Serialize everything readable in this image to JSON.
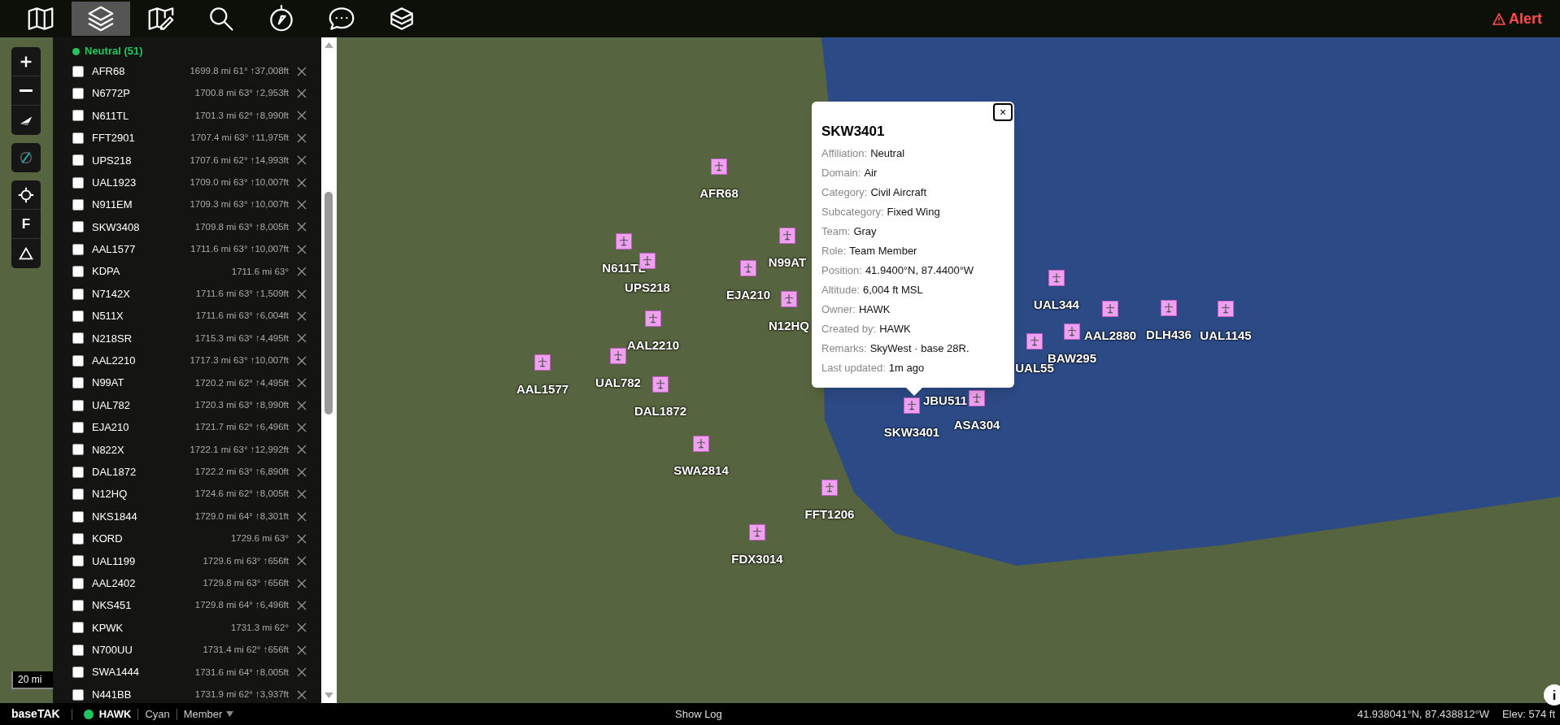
{
  "toolbar": {
    "tools": [
      {
        "kind": "map",
        "selected": false
      },
      {
        "kind": "layers",
        "selected": true
      },
      {
        "kind": "map-edit",
        "selected": false
      },
      {
        "kind": "search",
        "selected": false
      },
      {
        "kind": "compass",
        "selected": false
      },
      {
        "kind": "chat",
        "selected": false
      },
      {
        "kind": "stack",
        "selected": false
      }
    ],
    "alert": {
      "label": "Alert"
    }
  },
  "map_controls": [
    {
      "buttons": [
        {
          "kind": "zoom-in"
        },
        {
          "kind": "zoom-out"
        },
        {
          "kind": "north"
        }
      ]
    },
    {
      "buttons": [
        {
          "kind": "compass-off"
        }
      ]
    },
    {
      "buttons": [
        {
          "kind": "locate"
        },
        {
          "kind": "text",
          "label": "F"
        },
        {
          "kind": "triangle"
        }
      ]
    }
  ],
  "scale": "20 mi",
  "contacts": {
    "group": {
      "label": "Neutral (51)",
      "color": "#22c55e"
    },
    "items": [
      {
        "callsign": "AFR68",
        "info": "1699.8 mi 61° ↑37,008ft",
        "checked": false
      },
      {
        "callsign": "N6772P",
        "info": "1700.8 mi 63° ↑2,953ft",
        "checked": false
      },
      {
        "callsign": "N611TL",
        "info": "1701.3 mi 62° ↑8,990ft",
        "checked": false
      },
      {
        "callsign": "FFT2901",
        "info": "1707.4 mi 63° ↑11,975ft",
        "checked": false
      },
      {
        "callsign": "UPS218",
        "info": "1707.6 mi 62° ↑14,993ft",
        "checked": false
      },
      {
        "callsign": "UAL1923",
        "info": "1709.0 mi 63° ↑10,007ft",
        "checked": false
      },
      {
        "callsign": "N911EM",
        "info": "1709.3 mi 63° ↑10,007ft",
        "checked": false
      },
      {
        "callsign": "SKW3408",
        "info": "1709.8 mi 63° ↑8,005ft",
        "checked": false
      },
      {
        "callsign": "AAL1577",
        "info": "1711.6 mi 63° ↑10,007ft",
        "checked": false
      },
      {
        "callsign": "KDPA",
        "info": "1711.6 mi 63°",
        "checked": false
      },
      {
        "callsign": "N7142X",
        "info": "1711.6 mi 63° ↑1,509ft",
        "checked": false
      },
      {
        "callsign": "N511X",
        "info": "1711.6 mi 63° ↑6,004ft",
        "checked": false
      },
      {
        "callsign": "N218SR",
        "info": "1715.3 mi 63° ↑4,495ft",
        "checked": false
      },
      {
        "callsign": "AAL2210",
        "info": "1717.3 mi 63° ↑10,007ft",
        "checked": false
      },
      {
        "callsign": "N99AT",
        "info": "1720.2 mi 62° ↑4,495ft",
        "checked": false
      },
      {
        "callsign": "UAL782",
        "info": "1720.3 mi 63° ↑8,990ft",
        "checked": false
      },
      {
        "callsign": "EJA210",
        "info": "1721.7 mi 62° ↑6,496ft",
        "checked": false
      },
      {
        "callsign": "N822X",
        "info": "1722.1 mi 63° ↑12,992ft",
        "checked": false
      },
      {
        "callsign": "DAL1872",
        "info": "1722.2 mi 63° ↑6,890ft",
        "checked": false
      },
      {
        "callsign": "N12HQ",
        "info": "1724.6 mi 62° ↑8,005ft",
        "checked": false
      },
      {
        "callsign": "NKS1844",
        "info": "1729.0 mi 64° ↑8,301ft",
        "checked": false
      },
      {
        "callsign": "KORD",
        "info": "1729.6 mi 63°",
        "checked": false
      },
      {
        "callsign": "UAL1199",
        "info": "1729.6 mi 63° ↑656ft",
        "checked": false
      },
      {
        "callsign": "AAL2402",
        "info": "1729.8 mi 63° ↑656ft",
        "checked": false
      },
      {
        "callsign": "NKS451",
        "info": "1729.8 mi 64° ↑6,496ft",
        "checked": false
      },
      {
        "callsign": "KPWK",
        "info": "1731.3 mi 62°",
        "checked": false
      },
      {
        "callsign": "N700UU",
        "info": "1731.4 mi 62° ↑656ft",
        "checked": false
      },
      {
        "callsign": "SWA1444",
        "info": "1731.6 mi 64° ↑8,005ft",
        "checked": false
      },
      {
        "callsign": "N441BB",
        "info": "1731.9 mi 62° ↑3,937ft",
        "checked": false
      }
    ]
  },
  "markers": [
    {
      "label": "AFR68"
    },
    {
      "label": "N99AT"
    },
    {
      "label": "N611TL"
    },
    {
      "label": "UPS218"
    },
    {
      "label": "EJA210"
    },
    {
      "label": "UAL344"
    },
    {
      "label": "N12HQ"
    },
    {
      "label": "AAL2880"
    },
    {
      "label": "DLH436"
    },
    {
      "label": "UAL1145"
    },
    {
      "label": "AAL2210"
    },
    {
      "label": "BAW295"
    },
    {
      "label": "UAL55"
    },
    {
      "label": "UAL782"
    },
    {
      "label": "AAL1577"
    },
    {
      "label": "JBU511"
    },
    {
      "label": "DAL1872"
    },
    {
      "label": "ASA304"
    },
    {
      "label": "SKW3401"
    },
    {
      "label": "SWA2814"
    },
    {
      "label": "FFT1206"
    },
    {
      "label": "FDX3014"
    }
  ],
  "popup": {
    "title": "SKW3401",
    "fields": [
      {
        "label": "Affiliation:",
        "value": "Neutral"
      },
      {
        "label": "Domain:",
        "value": "Air"
      },
      {
        "label": "Category:",
        "value": "Civil Aircraft"
      },
      {
        "label": "Subcategory:",
        "value": "Fixed Wing"
      },
      {
        "label": "Team:",
        "value": "Gray"
      },
      {
        "label": "Role:",
        "value": "Team Member"
      },
      {
        "label": "Position:",
        "value": "41.9400°N, 87.4400°W"
      },
      {
        "label": "Altitude:",
        "value": "6,004 ft MSL"
      },
      {
        "label": "Owner:",
        "value": "HAWK"
      },
      {
        "label": "Created by:",
        "value": "HAWK"
      },
      {
        "label": "Remarks:",
        "value": "SkyWest · base 28R."
      },
      {
        "label": "Last updated:",
        "value": "1m ago"
      }
    ],
    "close": "×"
  },
  "status_bar": {
    "app": "baseTAK",
    "user": "HAWK",
    "online": true,
    "team": "Cyan",
    "role": "Member",
    "log_button": "Show Log",
    "coordinates": "41.938041°N, 87.438812°W",
    "elevation": "Elev: 574 ft"
  }
}
